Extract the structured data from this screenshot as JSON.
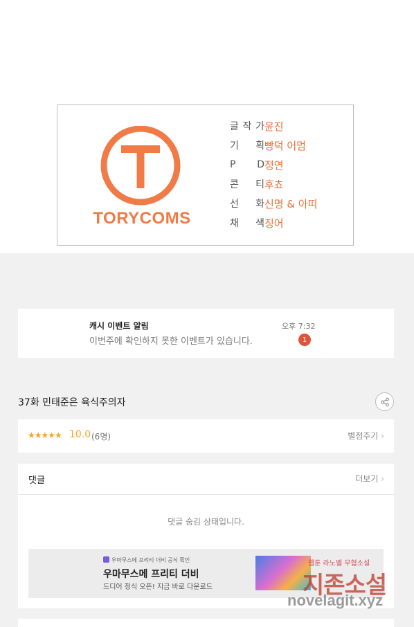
{
  "credits": {
    "logo_text": "TORYCOMS",
    "rows": [
      {
        "role": "글작가",
        "role_chars": [
          "글",
          "작",
          "가"
        ],
        "name": "윤진"
      },
      {
        "role": "기 획",
        "role_chars": [
          "기",
          "획"
        ],
        "name": "빵덕 어멈"
      },
      {
        "role": "P D",
        "role_chars": [
          "P",
          "D"
        ],
        "name": "정연"
      },
      {
        "role": "콘 티",
        "role_chars": [
          "콘",
          "티"
        ],
        "name": "후쵸"
      },
      {
        "role": "선 화",
        "role_chars": [
          "선",
          "화"
        ],
        "name": "신명 & 아띠"
      },
      {
        "role": "채 색",
        "role_chars": [
          "채",
          "색"
        ],
        "name": "징어"
      }
    ],
    "accent_color": "#f07b47"
  },
  "notice": {
    "title": "캐시 이벤트 알림",
    "body": "이번주에 확인하지 못한 이벤트가 있습니다.",
    "time": "오후 7:32",
    "badge": "1"
  },
  "episode": {
    "title": "37화 민태준은 육식주의자",
    "share_icon": "share-icon"
  },
  "rating": {
    "stars": "★★★★★",
    "score": "10.0",
    "votes": "(6명)",
    "rate_label": "별점주기",
    "star_value": 5
  },
  "comments": {
    "title": "댓글",
    "more_label": "더보기",
    "hidden_message": "댓글 숨김 상태입니다."
  },
  "ad": {
    "small_text": "우마무스메 프리티 더비 공식 확인",
    "title": "우마무스메 프리티 더비",
    "subtitle": "드디어 정식 오픈! 지금 바로 다운로드"
  },
  "watermark": {
    "top": "웹툰 라노벨 무협소설",
    "big": "지존소설",
    "url": "novelagit.xyz"
  }
}
